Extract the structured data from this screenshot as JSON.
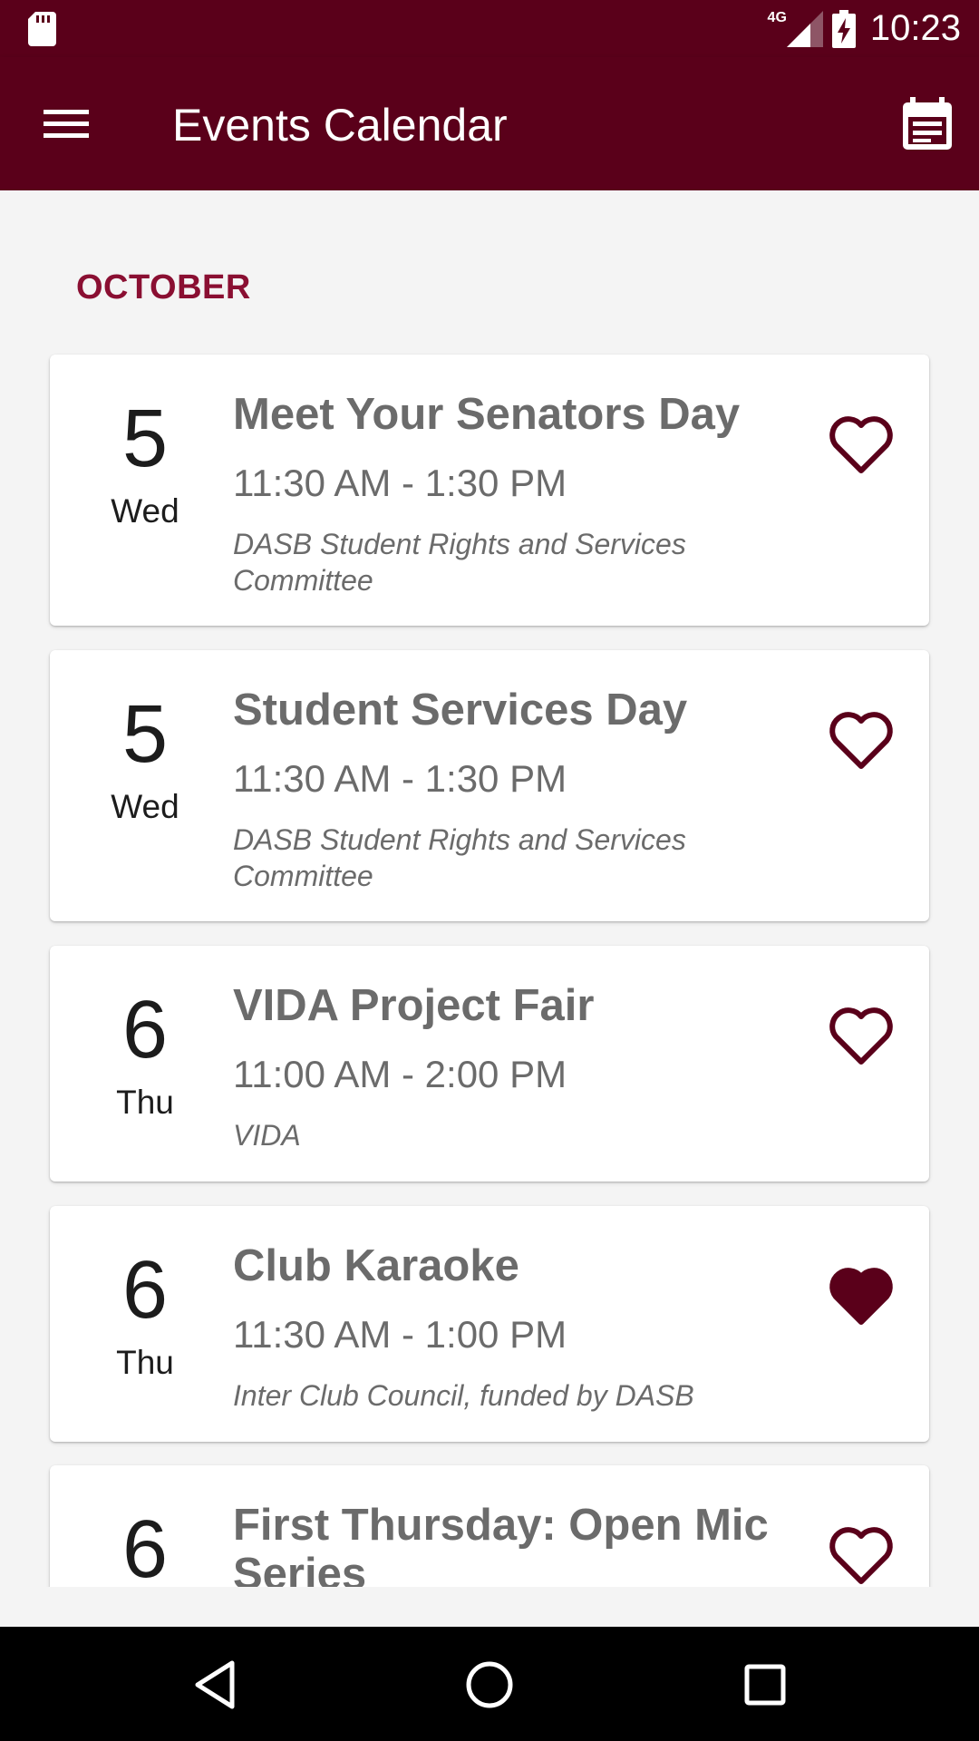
{
  "status_bar": {
    "network_type": "4G",
    "time": "10:23"
  },
  "app_bar": {
    "title": "Events Calendar",
    "menu_icon": "hamburger-menu-icon",
    "calendar_icon": "calendar-icon",
    "background_color": "#5a001a"
  },
  "month": "OCTOBER",
  "events": [
    {
      "day": "5",
      "weekday": "Wed",
      "title": "Meet Your Senators Day",
      "time": "11:30 AM - 1:30 PM",
      "organizer": "DASB Student Rights and Services Committee",
      "favorited": false
    },
    {
      "day": "5",
      "weekday": "Wed",
      "title": "Student Services Day",
      "time": "11:30 AM - 1:30 PM",
      "organizer": "DASB Student Rights and Services Committee",
      "favorited": false
    },
    {
      "day": "6",
      "weekday": "Thu",
      "title": "VIDA Project Fair",
      "time": "11:00 AM - 2:00 PM",
      "organizer": "VIDA",
      "favorited": false
    },
    {
      "day": "6",
      "weekday": "Thu",
      "title": "Club Karaoke",
      "time": "11:30 AM - 1:00 PM",
      "organizer": "Inter Club Council, funded by DASB",
      "favorited": true
    },
    {
      "day": "6",
      "title": "First Thursday: Open Mic Series",
      "favorited": false
    }
  ],
  "colors": {
    "accent": "#5a001a",
    "month_heading": "#8a0f32",
    "text_muted": "#6b6b6b"
  },
  "nav_bar": {
    "back_icon": "back-triangle-icon",
    "home_icon": "home-circle-icon",
    "recents_icon": "recents-square-icon"
  }
}
